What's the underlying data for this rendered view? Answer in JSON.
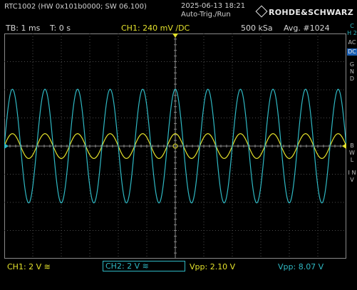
{
  "header": {
    "model": "RTC1002 (HW 0x101b0000; SW 06.100)",
    "date": "2025-06-13 18:21",
    "mode": "Auto-Trig./Run",
    "brand": "ROHDE&SCHWARZ"
  },
  "status": {
    "timebase": "TB: 1 ms",
    "time_offset": "T: 0 s",
    "ch1_trigger": "CH1: 240 mV /DC",
    "sample_rate": "500 kSa",
    "averaging": "Avg. #1024"
  },
  "side": {
    "channel": "C H 2",
    "ac": "AC",
    "dc": "DC",
    "gnd": "G N D",
    "bwl": "B W L",
    "inv": "I N V"
  },
  "bottom": {
    "ch1_scale": "CH1: 2 V ≋",
    "ch2_scale": "CH2: 2 V ≋",
    "vpp1": "Vpp: 2.10 V",
    "vpp2": "Vpp: 8.07 V"
  },
  "colors": {
    "ch1": "#e4e22c",
    "ch2": "#2fb8c3",
    "grid": "#4a4a4a"
  },
  "chart_data": {
    "type": "line",
    "xlabel": "",
    "ylabel": "",
    "x_divisions": 12,
    "y_divisions": 8,
    "xlim": [
      -6,
      6
    ],
    "ylim": [
      -4,
      4
    ],
    "series": [
      {
        "name": "CH1",
        "amplitude_div": 0.44,
        "cycles": 10.5,
        "phase": 0.0,
        "color": "#e4e22c"
      },
      {
        "name": "CH2",
        "amplitude_div": 2.02,
        "cycles": 10.5,
        "phase": 0.0,
        "color": "#2fb8c3"
      }
    ]
  }
}
